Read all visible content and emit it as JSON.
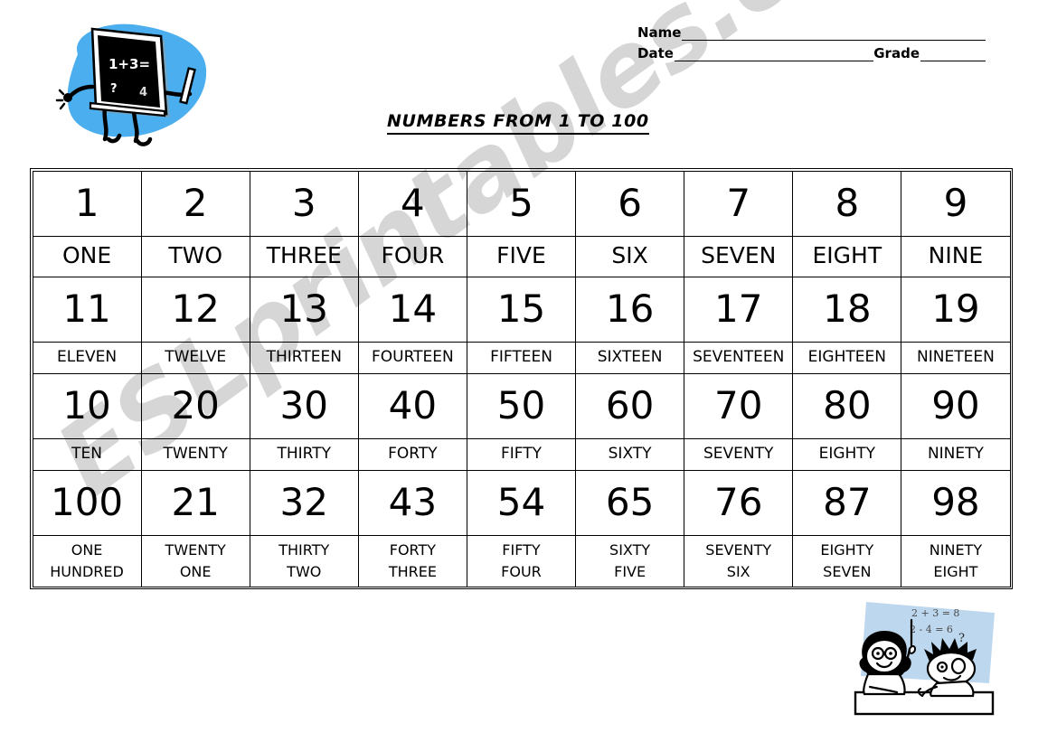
{
  "page": {
    "title": "NUMBERS FROM 1 TO 100",
    "watermark": "ESLprintables.com",
    "background_color": "#ffffff",
    "accent_blue": "#4BAEEE",
    "light_blue": "#BDD7EE",
    "ink_color": "#000000"
  },
  "header": {
    "name_label": "Name",
    "date_label": "Date",
    "grade_label": "Grade"
  },
  "clipart": {
    "blackboard": {
      "name": "walking-blackboard",
      "chalk_line_1": "1+3=",
      "chalk_line_2": "?",
      "blob_color": "#4BAEEE",
      "board_color": "#000000"
    },
    "students": {
      "name": "two-students-at-desk",
      "board_color": "#BDD7EE",
      "equation_1": "2 + 3 = 8",
      "equation_2": "2 - 4 = 6",
      "question_mark": "?"
    }
  },
  "table": {
    "columns": 9,
    "rows": [
      {
        "type": "digits",
        "cells": [
          "1",
          "2",
          "3",
          "4",
          "5",
          "6",
          "7",
          "8",
          "9"
        ]
      },
      {
        "type": "words-large",
        "cells": [
          "ONE",
          "TWO",
          "THREE",
          "FOUR",
          "FIVE",
          "SIX",
          "SEVEN",
          "EIGHT",
          "NINE"
        ]
      },
      {
        "type": "digits",
        "cells": [
          "11",
          "12",
          "13",
          "14",
          "15",
          "16",
          "17",
          "18",
          "19"
        ]
      },
      {
        "type": "words-medium",
        "cells": [
          "ELEVEN",
          "TWELVE",
          "THIRTEEN",
          "FOURTEEN",
          "FIFTEEN",
          "SIXTEEN",
          "SEVENTEEN",
          "EIGHTEEN",
          "NINETEEN"
        ]
      },
      {
        "type": "digits",
        "cells": [
          "10",
          "20",
          "30",
          "40",
          "50",
          "60",
          "70",
          "80",
          "90"
        ]
      },
      {
        "type": "words-medium",
        "cells": [
          "TEN",
          "TWENTY",
          "THIRTY",
          "FORTY",
          "FIFTY",
          "SIXTY",
          "SEVENTY",
          "EIGHTY",
          "NINETY"
        ]
      },
      {
        "type": "digits",
        "cells": [
          "100",
          "21",
          "32",
          "43",
          "54",
          "65",
          "76",
          "87",
          "98"
        ]
      },
      {
        "type": "words-two-line",
        "cells": [
          "ONE\nHUNDRED",
          "TWENTY\nONE",
          "THIRTY\nTWO",
          "FORTY\nTHREE",
          "FIFTY\nFOUR",
          "SIXTY\nFIVE",
          "SEVENTY\nSIX",
          "EIGHTY\nSEVEN",
          "NINETY\nEIGHT"
        ]
      }
    ]
  }
}
